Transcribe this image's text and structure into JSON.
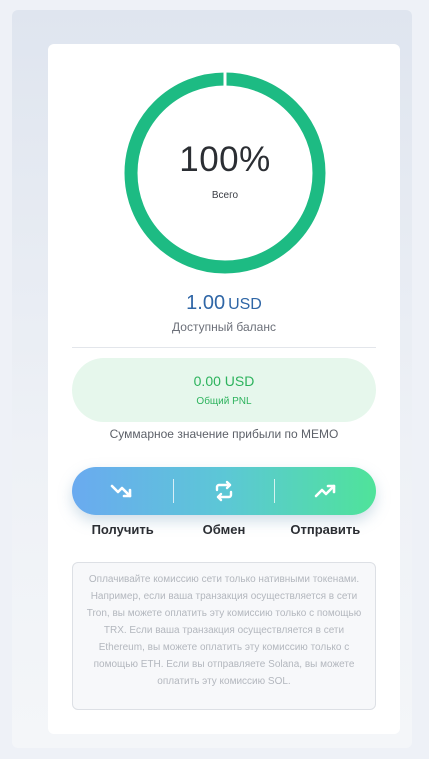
{
  "wallet": {
    "percent": "100%",
    "percent_fraction": 1.0,
    "total_label": "Всего",
    "ring_color": "#1dbb83",
    "balance_amount": "1.00",
    "balance_currency": "USD",
    "balance_label": "Доступный баланс",
    "pnl_value": "0.00 USD",
    "pnl_label": "Общий PNL",
    "memo_text": "Суммарное значение прибыли по MEMO"
  },
  "actions": [
    {
      "label": "Получить",
      "icon": "trend-down-icon"
    },
    {
      "label": "Обмен",
      "icon": "exchange-icon"
    },
    {
      "label": "Отправить",
      "icon": "trend-up-icon"
    }
  ],
  "notice": {
    "text": "Оплачивайте комиссию сети только нативными токенами. Например, если ваша транзакция осуществляется в сети Tron, вы можете оплатить эту комиссию только с помощью TRX. Если ваша транзакция осуществляется в сети Ethereum, вы можете оплатить эту комиссию только с помощью ETH. Если вы отправляете Solana, вы можете оплатить эту комиссию SOL."
  }
}
